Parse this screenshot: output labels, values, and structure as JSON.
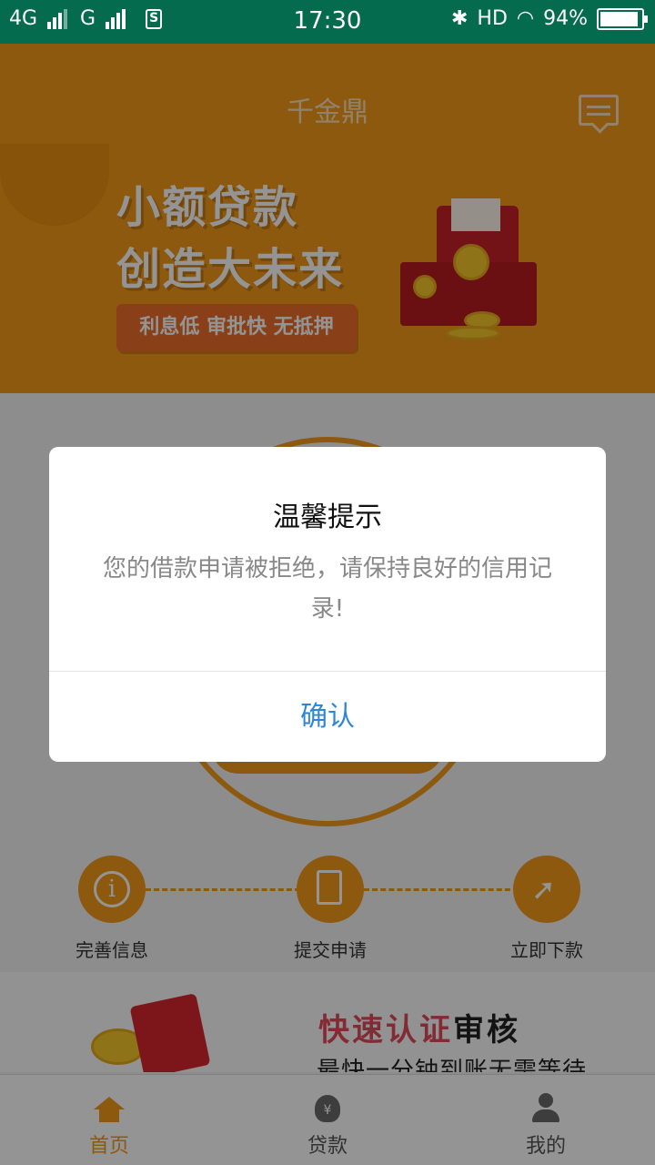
{
  "status_bar": {
    "network1": "4G",
    "network2": "G",
    "time": "17:30",
    "hd": "HD",
    "battery_percent": "94%",
    "battery_level": 0.94
  },
  "header": {
    "app_title": "千金鼎"
  },
  "banner": {
    "slogan_line1": "小额贷款",
    "slogan_line2": "创造大未来",
    "tagline": "利息低 审批快 无抵押"
  },
  "steps": [
    {
      "label": "完善信息",
      "icon": "info-icon"
    },
    {
      "label": "提交申请",
      "icon": "document-edit-icon"
    },
    {
      "label": "立即下款",
      "icon": "rocket-icon"
    }
  ],
  "promo": {
    "title_highlight": "快速认证",
    "title_rest": "审核",
    "subtitle": "最快一分钟到账无需等待"
  },
  "tabbar": {
    "items": [
      {
        "label": "首页",
        "icon": "home-icon",
        "active": true
      },
      {
        "label": "贷款",
        "icon": "money-bag-icon",
        "active": false
      },
      {
        "label": "我的",
        "icon": "user-icon",
        "active": false
      }
    ]
  },
  "dialog": {
    "title": "温馨提示",
    "message": "您的借款申请被拒绝，请保持良好的信用记录!",
    "confirm_label": "确认"
  },
  "colors": {
    "status_bar": "#046b4f",
    "brand_orange": "#f19a1a",
    "dialog_button": "#2d86d6"
  }
}
